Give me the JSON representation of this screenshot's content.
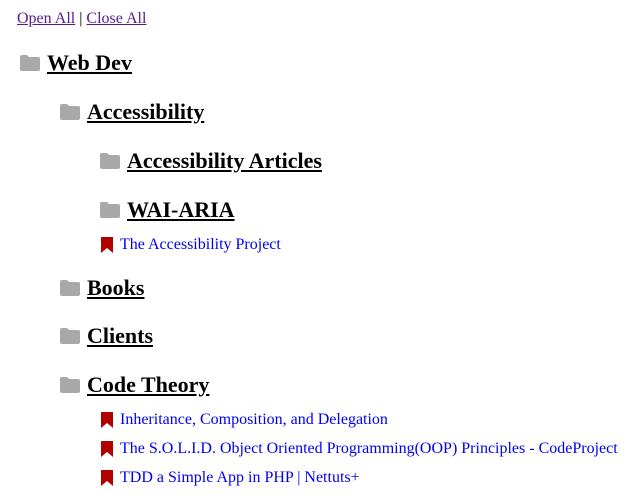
{
  "toolbar": {
    "open_all": "Open All",
    "separator": "|",
    "close_all": "Close All"
  },
  "colors": {
    "folder_icon": "#a9a9a9",
    "bookmark_icon": "#b00000",
    "link_text": "#0000ee",
    "visited_link": "#551a8b"
  },
  "tree": {
    "web_dev": "Web Dev",
    "accessibility": "Accessibility",
    "accessibility_articles": "Accessibility Articles",
    "wai_aria": "WAI-ARIA",
    "accessibility_project": "The Accessibility Project",
    "books": "Books",
    "clients": "Clients",
    "code_theory": "Code Theory",
    "link_inheritance": "Inheritance, Composition, and Delegation",
    "link_solid": "The S.O.L.I.D. Object Oriented Programming(OOP) Principles - CodeProject",
    "link_tdd": "TDD a Simple App in PHP | Nettuts+"
  }
}
